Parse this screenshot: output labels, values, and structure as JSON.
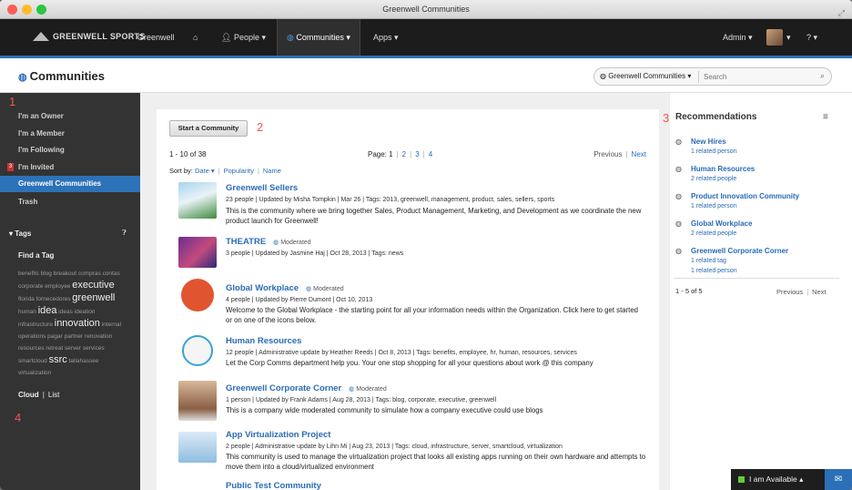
{
  "window": {
    "title": "Greenwell Communities"
  },
  "nav": {
    "logo": "GREENWELL SPORTS",
    "items": [
      "Greenwell",
      "People ▾",
      "Communities ▾",
      "Apps ▾"
    ],
    "admin": "Admin ▾",
    "avatar_caret": "▾",
    "help": "? ▾"
  },
  "header": {
    "title": "Communities",
    "scope": "Greenwell Communities ▾",
    "search_placeholder": "Search"
  },
  "sidebar": {
    "items": [
      "I'm an Owner",
      "I'm a Member",
      "I'm Following",
      "I'm Invited",
      "Greenwell Communities",
      "Trash"
    ],
    "invite_badge": "3",
    "tags_heading": "Tags",
    "find_tag": "Find a Tag",
    "view_cloud": "Cloud",
    "view_list": "List",
    "callout_1": "1",
    "callout_4": "4"
  },
  "tags": [
    {
      "t": "benefits",
      "s": "s"
    },
    {
      "t": "blog",
      "s": "s"
    },
    {
      "t": "breakout",
      "s": "s"
    },
    {
      "t": "compras",
      "s": "s"
    },
    {
      "t": "contas",
      "s": "s"
    },
    {
      "t": "corporate",
      "s": "s"
    },
    {
      "t": "employee",
      "s": "s"
    },
    {
      "t": "executive",
      "s": "b"
    },
    {
      "t": "florida",
      "s": "s"
    },
    {
      "t": "fornecedores",
      "s": "s"
    },
    {
      "t": "greenwell",
      "s": "b"
    },
    {
      "t": "human",
      "s": "s"
    },
    {
      "t": "idea",
      "s": "b"
    },
    {
      "t": "ideas",
      "s": "s"
    },
    {
      "t": "ideation",
      "s": "s"
    },
    {
      "t": "infrastructure",
      "s": "s"
    },
    {
      "t": "innovation",
      "s": "b"
    },
    {
      "t": "internal",
      "s": "s"
    },
    {
      "t": "operations",
      "s": "s"
    },
    {
      "t": "pagar",
      "s": "s"
    },
    {
      "t": "partner",
      "s": "s"
    },
    {
      "t": "renovation",
      "s": "s"
    },
    {
      "t": "resources",
      "s": "s"
    },
    {
      "t": "retreat",
      "s": "s"
    },
    {
      "t": "server",
      "s": "s"
    },
    {
      "t": "services",
      "s": "s"
    },
    {
      "t": "smartcloud",
      "s": "s"
    },
    {
      "t": "ssrc",
      "s": "b"
    },
    {
      "t": "tallahassee",
      "s": "s"
    },
    {
      "t": "virtualization",
      "s": "s"
    }
  ],
  "main": {
    "start_button": "Start a Community",
    "callout_2": "2",
    "range": "1 - 10 of 38",
    "page_label": "Page:",
    "pages": [
      "1",
      "2",
      "3",
      "4"
    ],
    "previous": "Previous",
    "next": "Next",
    "sort_by": "Sort by:",
    "sort_date": "Date ▾",
    "sort_popularity": "Popularity",
    "sort_name": "Name",
    "moderated": "Moderated",
    "communities": [
      {
        "title": "Greenwell Sellers",
        "meta": "23 people  |  Updated by Misha Tompkin  |  Mar 26  |  Tags: 2013, greenwell, management, product, sales, sellers, sports",
        "desc": "This is the community where we bring together Sales, Product Management, Marketing, and Development as we coordinate the new product launch for Greenwell!"
      },
      {
        "title": "THEATRE",
        "meta": "3 people  |  Updated by Jasmine Haj  |  Oct 28, 2013  |  Tags: news",
        "desc": ""
      },
      {
        "title": "Global Workplace",
        "meta": "4 people  |  Updated by Pierre Dumont  |  Oct 10, 2013",
        "desc": "Welcome to the Global Workplace - the starting point for all your information needs within the Organization. Click here to get started or on one of the icons below."
      },
      {
        "title": "Human Resources",
        "meta": "12 people  |  Administrative update by Heather Reeds  |  Oct 8, 2013  |  Tags: benefits, employee, hr, human, resources, services",
        "desc": "Let the Corp Comms department help you. Your one stop shopping for all your questions about work @ this company"
      },
      {
        "title": "Greenwell Corporate Corner",
        "meta": "1 person  |  Updated by Frank Adams  |  Aug 28, 2013  |  Tags: blog, corporate, executive, greenwell",
        "desc": "This is a company wide moderated community to simulate how a company executive could use blogs"
      },
      {
        "title": "App Virtualization Project",
        "meta": "2 people  |  Administrative update by Lihn Mi  |  Aug 23, 2013  |  Tags: cloud, infrastructure, server, smartcloud, virtualization",
        "desc": "This community is used to manage the virtualization project that looks all existing apps running on their own hardware and attempts to move them into a cloud/virtualized environment"
      },
      {
        "title": "Public Test Community",
        "meta": "",
        "desc": ""
      }
    ]
  },
  "recommendations": {
    "title": "Recommendations",
    "callout_3": "3",
    "menu_icon": "menu-icon",
    "items": [
      {
        "name": "New Hires",
        "sub": [
          "1 related person"
        ]
      },
      {
        "name": "Human Resources",
        "sub": [
          "2 related people"
        ]
      },
      {
        "name": "Product Innovation Community",
        "sub": [
          "1 related person"
        ]
      },
      {
        "name": "Global Workplace",
        "sub": [
          "2 related people"
        ]
      },
      {
        "name": "Greenwell Corporate Corner",
        "sub": [
          "1 related tag",
          "1 related person"
        ]
      }
    ],
    "range": "1 - 5 of 5",
    "previous": "Previous",
    "next": "Next"
  },
  "chat": {
    "status": "I am Available ▴"
  },
  "colors": {
    "accent": "#2b6fb7",
    "nav_bg": "#1c1c1c",
    "sidebar_bg": "#333333",
    "selected": "#2c72b8",
    "callout": "#e55555"
  }
}
